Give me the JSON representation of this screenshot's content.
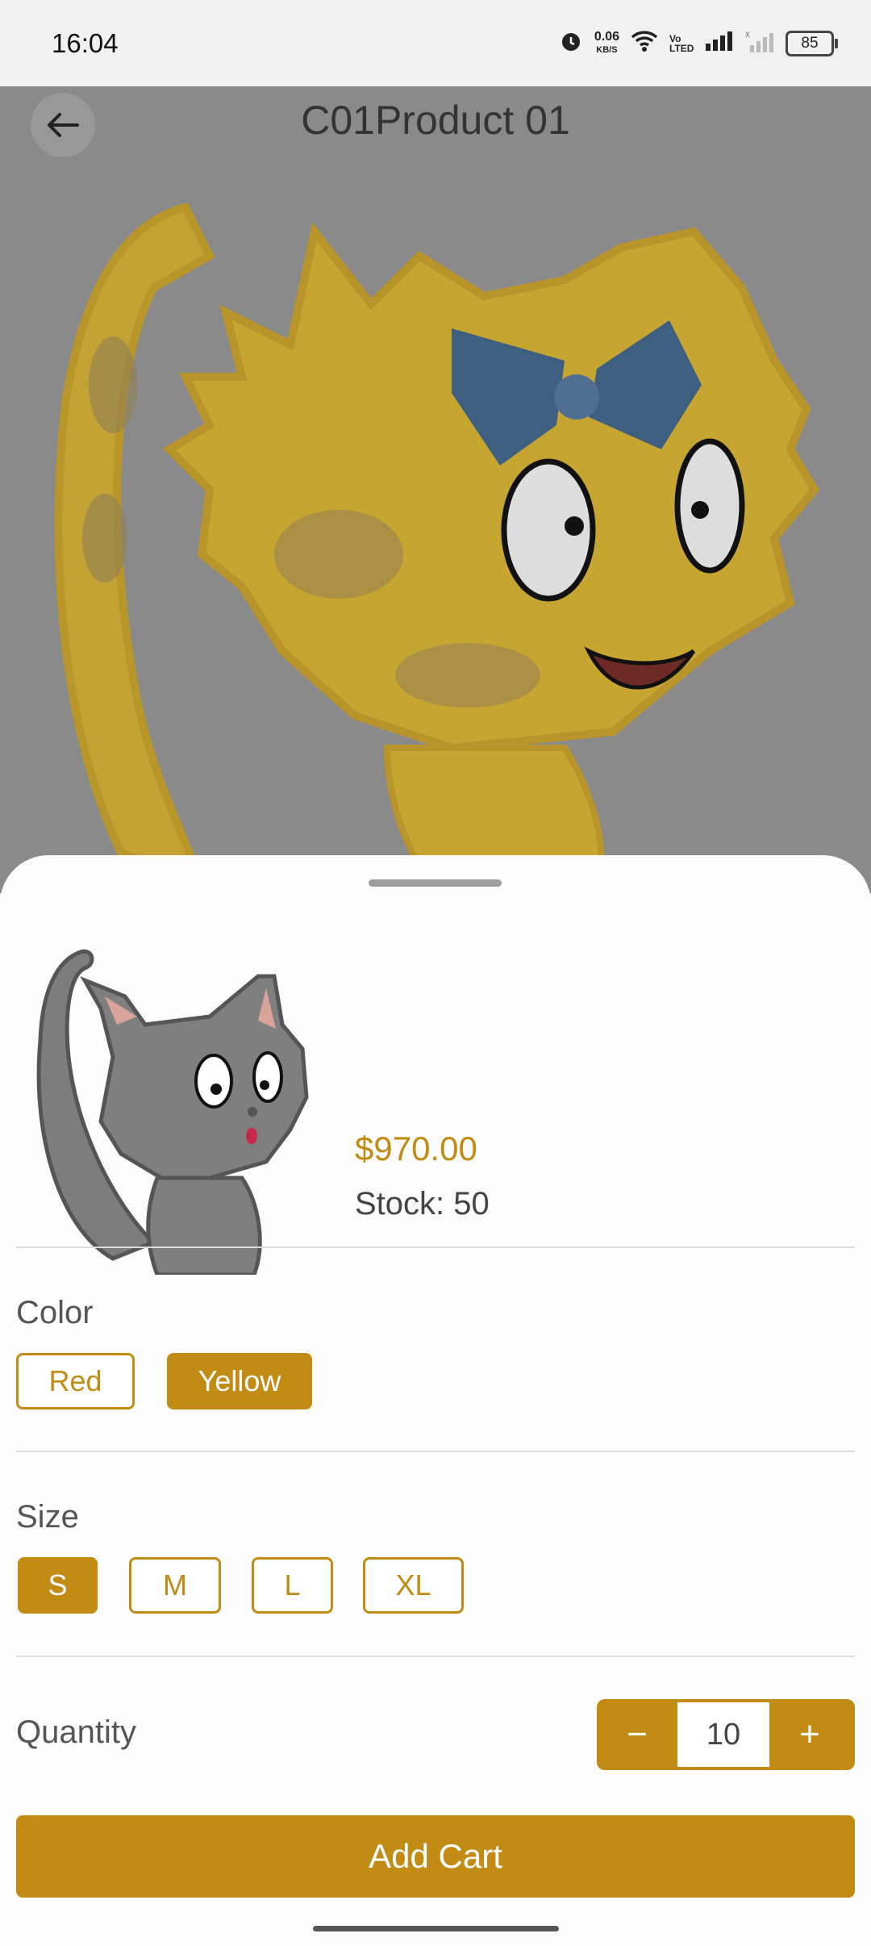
{
  "status_bar": {
    "time": "16:04",
    "speed_value": "0.06",
    "speed_unit": "KB/S",
    "battery": "85",
    "volte": "Vo LTED"
  },
  "header": {
    "title": "C01Product 01"
  },
  "product": {
    "price": "$970.00",
    "stock_label": "Stock: 50"
  },
  "color": {
    "label": "Color",
    "options": [
      "Red",
      "Yellow"
    ],
    "selected": "Yellow"
  },
  "size": {
    "label": "Size",
    "options": [
      "S",
      "M",
      "L",
      "XL"
    ],
    "selected": "S"
  },
  "quantity": {
    "label": "Quantity",
    "value": "10",
    "minus": "−",
    "plus": "+"
  },
  "add_cart_label": "Add Cart",
  "colors": {
    "accent": "#c18b14",
    "sheet": "#fcfcfc",
    "overlay_bg": "#8a8a8a"
  }
}
